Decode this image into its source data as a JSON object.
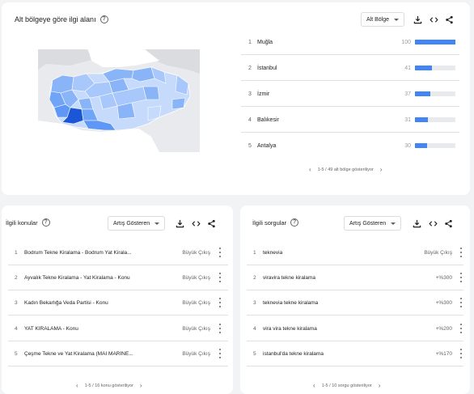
{
  "region": {
    "title": "Alt bölgeye göre ilgi alanı",
    "dropdown_label": "Alt Bölge",
    "rows": [
      {
        "rank": "1",
        "name": "Muğla",
        "value": "100",
        "share": 100
      },
      {
        "rank": "2",
        "name": "İstanbul",
        "value": "41",
        "share": 41
      },
      {
        "rank": "3",
        "name": "İzmir",
        "value": "37",
        "share": 37
      },
      {
        "rank": "4",
        "name": "Balıkesir",
        "value": "31",
        "share": 31
      },
      {
        "rank": "5",
        "name": "Antalya",
        "value": "30",
        "share": 30
      }
    ],
    "pager": "1-5 / 49 alt bölge gösteriliyor"
  },
  "topics": {
    "title": "İlgili konular",
    "dropdown_label": "Artış Gösteren",
    "rows": [
      {
        "rank": "1",
        "text": "Bodrum Tekne Kiralama - Bodrum Yat Kirala...",
        "metric": "Büyük Çıkış"
      },
      {
        "rank": "2",
        "text": "Ayvalık Tekne Kiralama - Yat Kiralama - Konu",
        "metric": "Büyük Çıkış"
      },
      {
        "rank": "3",
        "text": "Kadın Bekarlığa Veda Partisi - Konu",
        "metric": "Büyük Çıkış"
      },
      {
        "rank": "4",
        "text": "YAT KİRALAMA - Konu",
        "metric": "Büyük Çıkış"
      },
      {
        "rank": "5",
        "text": "Çeşme Tekne ve Yat Kiralama (MAI MARİNE...",
        "metric": "Büyük Çıkış"
      }
    ],
    "pager": "1-5 / 16 konu gösteriliyor"
  },
  "queries": {
    "title": "İlgili sorgular",
    "dropdown_label": "Artış Gösteren",
    "rows": [
      {
        "rank": "1",
        "text": "teknevia",
        "metric": "Büyük Çıkış"
      },
      {
        "rank": "2",
        "text": "viravira tekne kiralama",
        "metric": "+%300"
      },
      {
        "rank": "3",
        "text": "teknevia tekne kiralama",
        "metric": "+%300"
      },
      {
        "rank": "4",
        "text": "vira vira tekne kiralama",
        "metric": "+%200"
      },
      {
        "rank": "5",
        "text": "istanbul'da tekne kiralama",
        "metric": "+%170"
      }
    ],
    "pager": "1-5 / 10 sorgu gösteriliyor"
  },
  "icons": {
    "help": "help-circle-icon",
    "download": "download-icon",
    "embed": "code-icon",
    "share": "share-icon",
    "more": "more-vert-icon",
    "prev": "chevron-left-icon",
    "next": "chevron-right-icon"
  },
  "colors": {
    "accent": "#4285f4",
    "map_light": "#c6dafc",
    "map_mid": "#8ab4f8",
    "map_strong": "#4285f4",
    "map_peak": "#1a56d6",
    "map_background": "#e8eaed"
  }
}
